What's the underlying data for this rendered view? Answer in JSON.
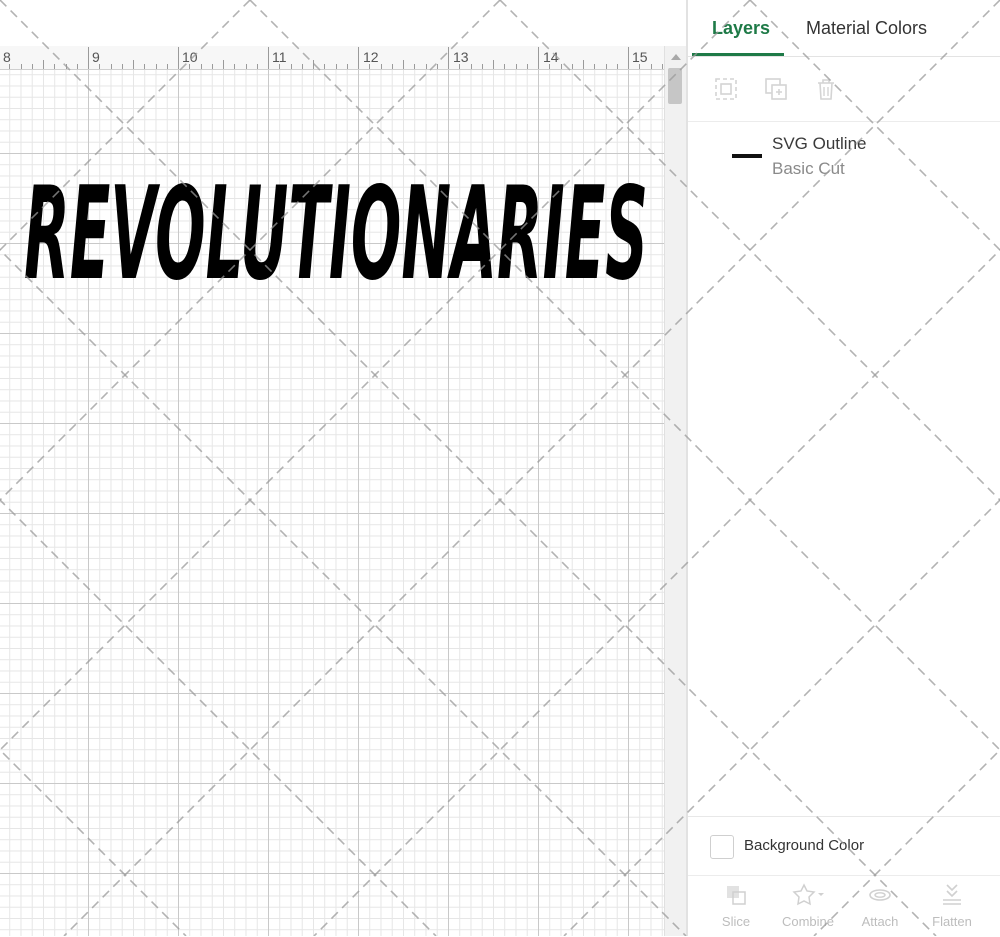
{
  "ruler": {
    "labels": [
      "8",
      "9",
      "10",
      "11",
      "12",
      "13",
      "14",
      "15"
    ]
  },
  "canvas": {
    "design_text": "REVOLUTIONARIES",
    "design_color": "#000000"
  },
  "tabs": {
    "layers_label": "Layers",
    "material_label": "Material Colors",
    "active": "Layers",
    "accent_color": "#1e7a47"
  },
  "layer_actions": {
    "icons": [
      "group-icon",
      "duplicate-icon",
      "delete-icon"
    ]
  },
  "layer": {
    "name": "SVG Outline",
    "operation": "Basic Cut"
  },
  "background": {
    "label": "Background Color"
  },
  "toolbar": {
    "slice_label": "Slice",
    "combine_label": "Combine",
    "attach_label": "Attach",
    "flatten_label": "Flatten"
  }
}
